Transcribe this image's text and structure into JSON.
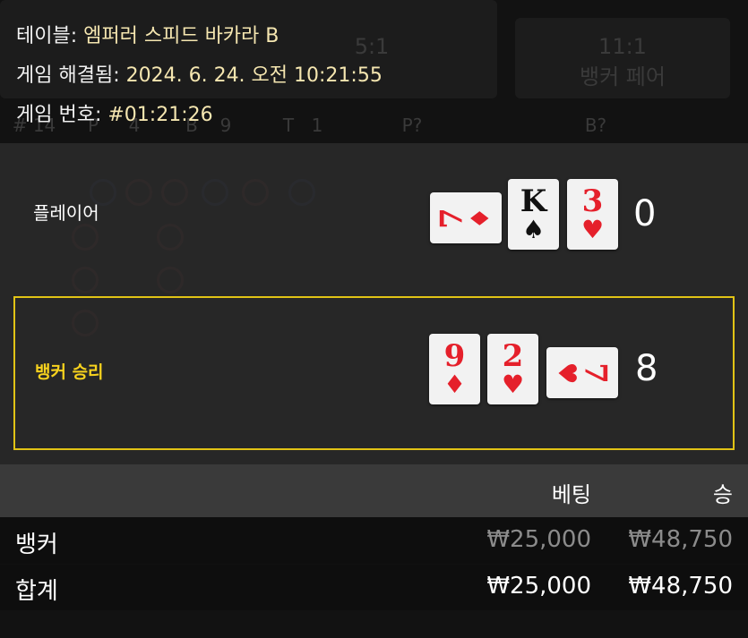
{
  "header": {
    "table_label": "테이블:",
    "table_value": "엠퍼러 스피드 바카라 B",
    "resolved_label": "게임 해결됨:",
    "resolved_value": "2024. 6. 24. 오전 10:21:55",
    "number_label": "게임 번호:",
    "number_value": "#01:21:26"
  },
  "background": {
    "bet_spot_1": {
      "odds": "5:1"
    },
    "bet_spot_2": {
      "odds": "11:1",
      "label": "뱅커 페어"
    },
    "stats": [
      "# 14",
      "P",
      "4",
      "B",
      "9",
      "T",
      "1",
      "P?",
      "B?"
    ]
  },
  "result": {
    "player": {
      "label": "플레이어",
      "score": "0",
      "cards": [
        {
          "rank": "7",
          "suit": "♦",
          "color": "red"
        },
        {
          "rank": "K",
          "suit": "♠",
          "color": "black"
        },
        {
          "rank": "3",
          "suit": "♥",
          "color": "red"
        }
      ]
    },
    "banker": {
      "label": "뱅커 승리",
      "score": "8",
      "cards": [
        {
          "rank": "9",
          "suit": "♦",
          "color": "red"
        },
        {
          "rank": "2",
          "suit": "♥",
          "color": "red"
        },
        {
          "rank": "7",
          "suit": "♥",
          "color": "red"
        }
      ]
    }
  },
  "bets_table": {
    "columns": [
      "베팅",
      "승"
    ],
    "rows": [
      {
        "label": "뱅커",
        "bet": "₩25,000",
        "win": "₩48,750"
      },
      {
        "label": "합계",
        "bet": "₩25,000",
        "win": "₩48,750"
      }
    ]
  },
  "colors": {
    "highlight": "#f7d21e",
    "card_red": "#e5202b",
    "panel": "#2c2c2c"
  }
}
